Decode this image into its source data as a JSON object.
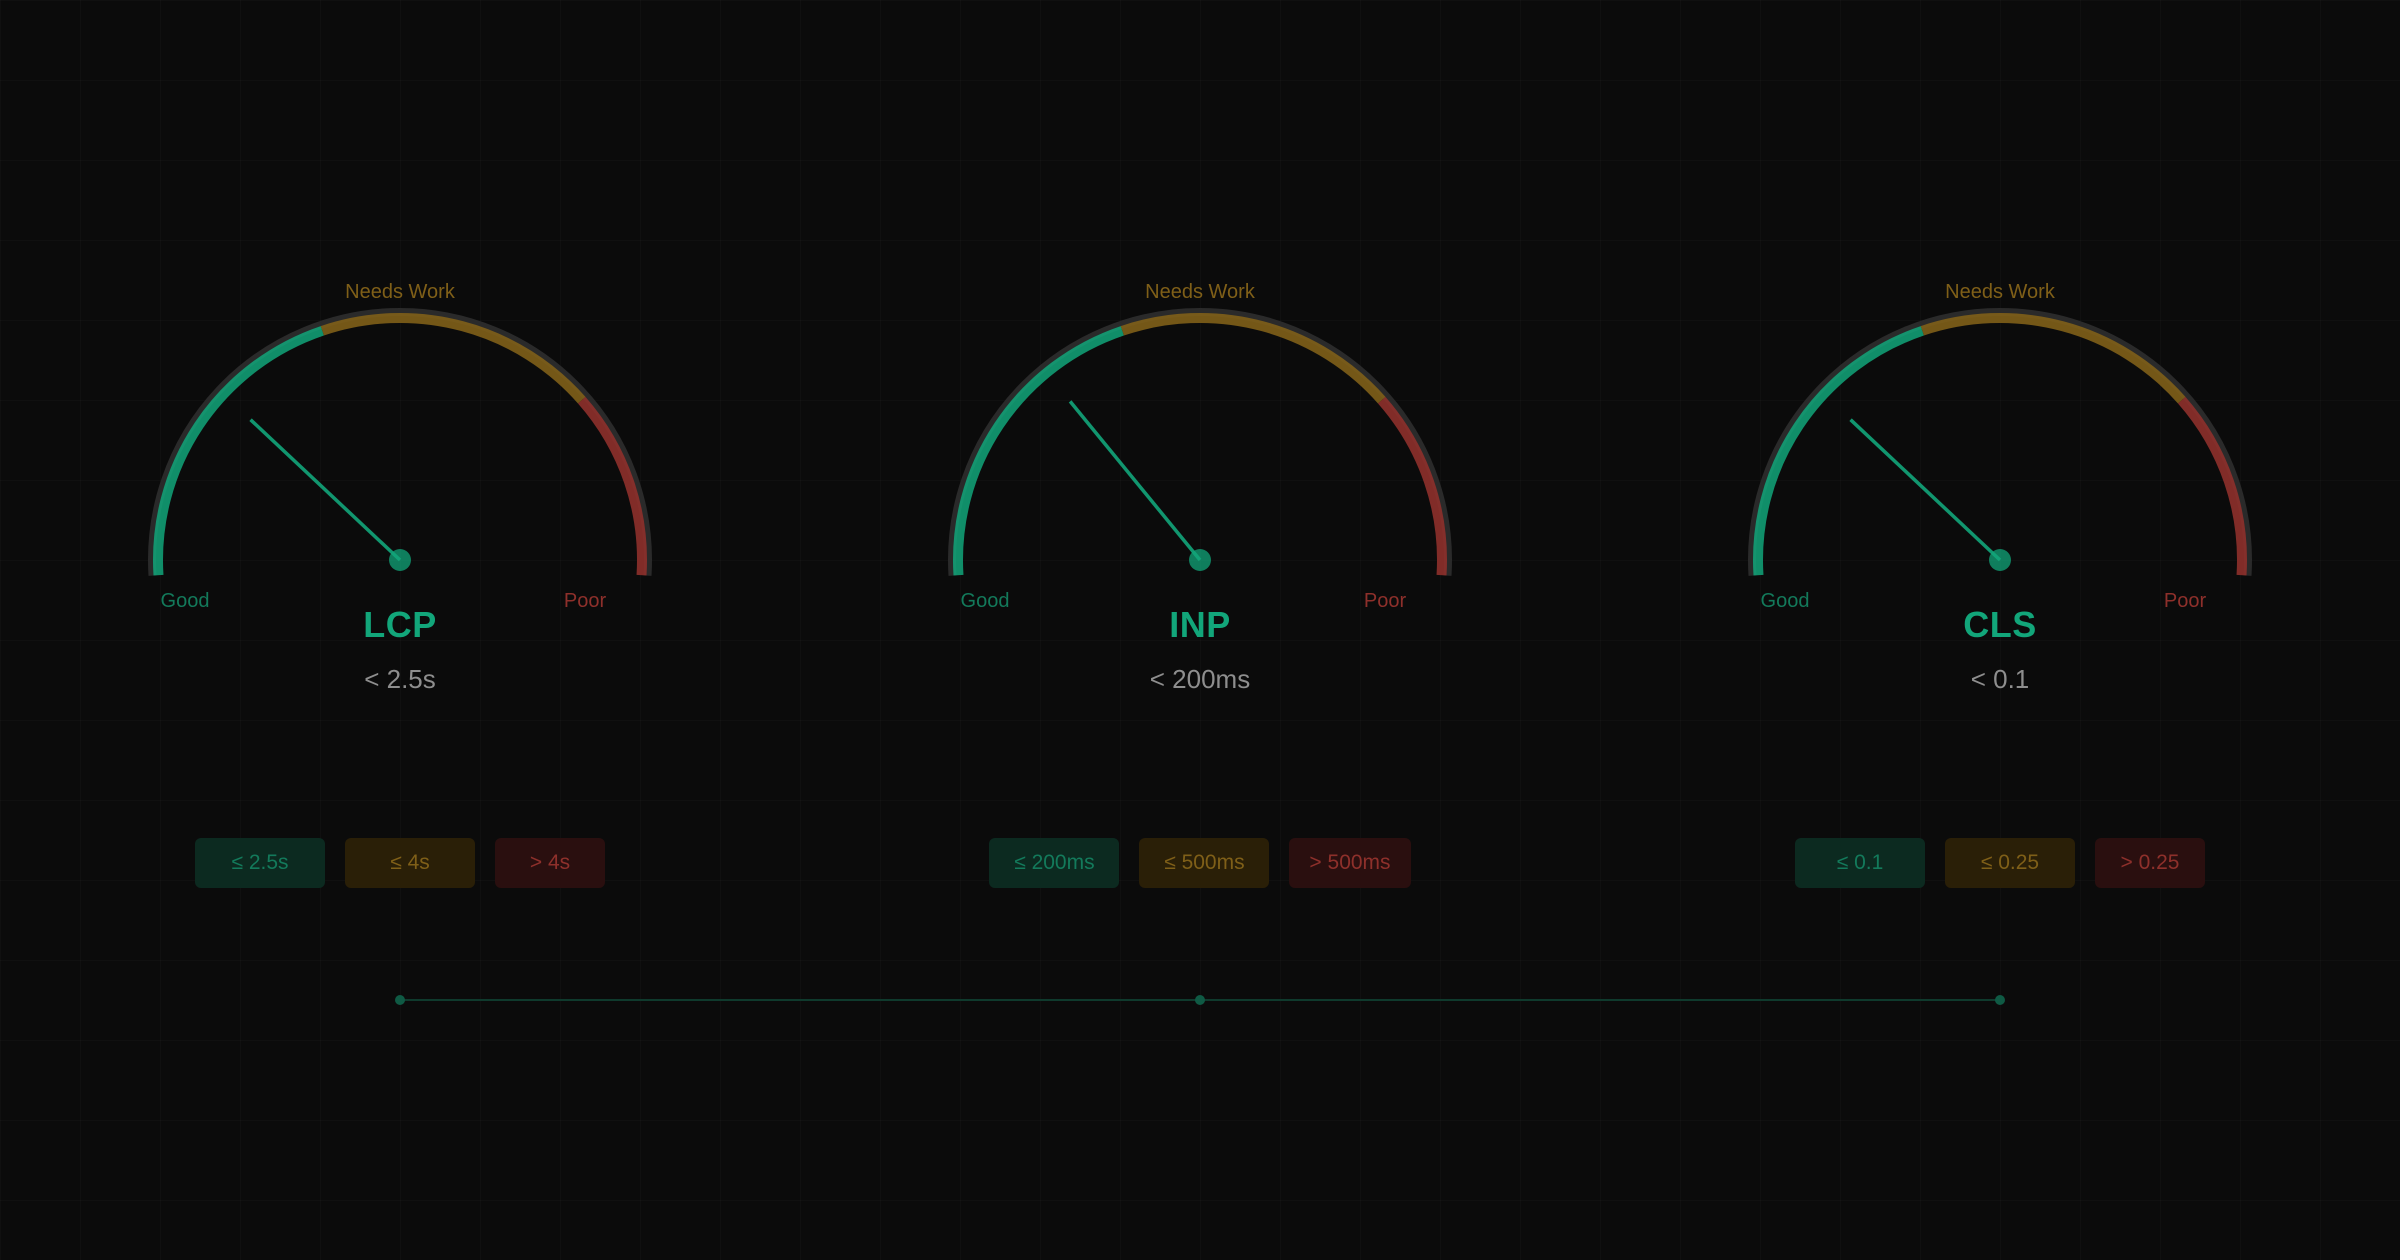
{
  "colors": {
    "background": "#0b0b0b",
    "good": "#12a67a",
    "needs_work": "#7f5f18",
    "poor": "#8e302b",
    "track": "#2a2a2a"
  },
  "gauges": [
    {
      "name": "LCP",
      "target": "< 2.5s",
      "needs_work_label": "Needs Work",
      "good_label": "Good",
      "poor_label": "Poor",
      "needle_fraction": 0.25,
      "thresholds": [
        "≤ 2.5s",
        "≤ 4s",
        "> 4s"
      ]
    },
    {
      "name": "INP",
      "target": "< 200ms",
      "needs_work_label": "Needs Work",
      "good_label": "Good",
      "poor_label": "Poor",
      "needle_fraction": 0.29,
      "thresholds": [
        "≤ 200ms",
        "≤ 500ms",
        "> 500ms"
      ]
    },
    {
      "name": "CLS",
      "target": "< 0.1",
      "needs_work_label": "Needs Work",
      "good_label": "Good",
      "poor_label": "Poor",
      "needle_fraction": 0.25,
      "thresholds": [
        "≤ 0.1",
        "≤ 0.25",
        "> 0.25"
      ]
    }
  ]
}
